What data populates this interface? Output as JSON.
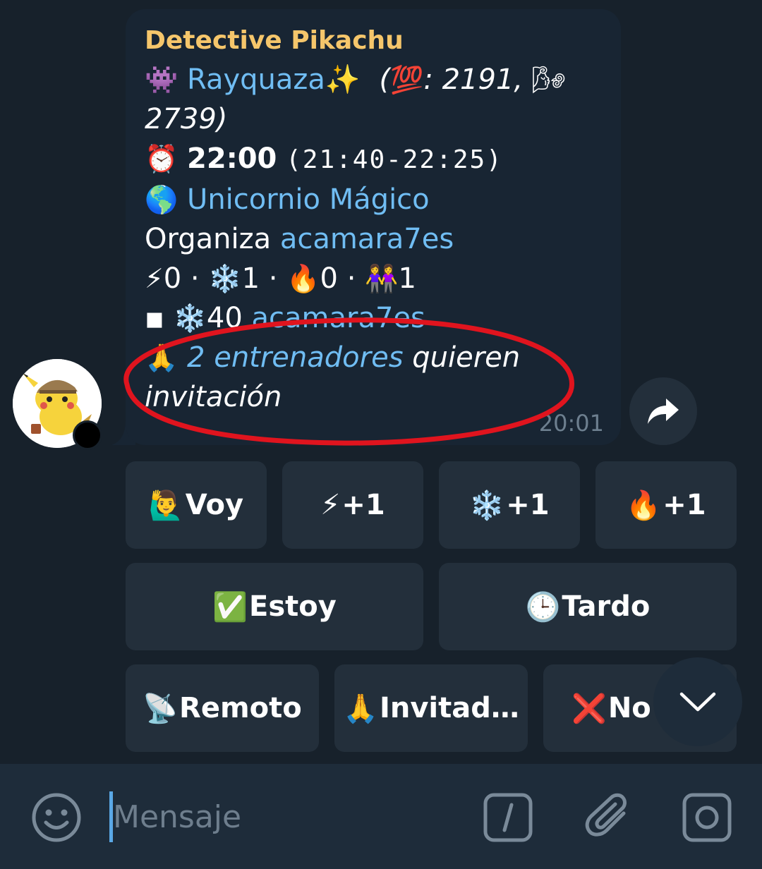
{
  "message": {
    "sender": "Detective Pikachu",
    "pokemon_icon": "👾",
    "pokemon_name": "Rayquaza✨",
    "stats_open": "(",
    "stats_cp_icon": "💯",
    "stats_cp": ": 2191, ",
    "stats_weather_icon": "🌬",
    "stats_weather_cp": "2739)",
    "time_icon": "⏰",
    "time_main": "22:00",
    "time_range": "(21:40-22:25)",
    "location_icon": "🌎",
    "location_name": "Unicornio Mágico",
    "organizer_label": "Organiza ",
    "organizer_name": "acamara7es",
    "counts_mystic_icon": "⚡",
    "counts_mystic": "0 · ",
    "counts_valor_icon": "❄️",
    "counts_valor": "1 · ",
    "counts_instinct_icon": "🔥",
    "counts_instinct": "0 · ",
    "counts_people_icon": "👭",
    "counts_people": "1",
    "attendee_icon": "◾",
    "attendee_team_icon": "❄️",
    "attendee_level": "40 ",
    "attendee_name": "acamara7es",
    "invite_icon": "🙏",
    "invite_link": "2 entrenadores",
    "invite_text": " quieren invitación",
    "timestamp": "20:01"
  },
  "buttons": {
    "row1": [
      {
        "icon": "🙋‍♂️",
        "label": "Voy"
      },
      {
        "icon": "⚡",
        "label": "+1"
      },
      {
        "icon": "❄️",
        "label": "+1"
      },
      {
        "icon": "🔥",
        "label": "+1"
      }
    ],
    "row2": [
      {
        "icon": "✅",
        "label": "Estoy"
      },
      {
        "icon": "🕒",
        "label": "Tardo"
      }
    ],
    "row3": [
      {
        "icon": "📡",
        "label": "Remoto"
      },
      {
        "icon": "🙏",
        "label": "Invitad…"
      },
      {
        "icon": "❌",
        "label": "No"
      }
    ]
  },
  "input": {
    "placeholder": "Mensaje"
  },
  "colors": {
    "background": "#17212b",
    "bubble": "#182533",
    "sender": "#f5c66b",
    "link": "#70bdf3",
    "annotation": "#e0141e"
  }
}
